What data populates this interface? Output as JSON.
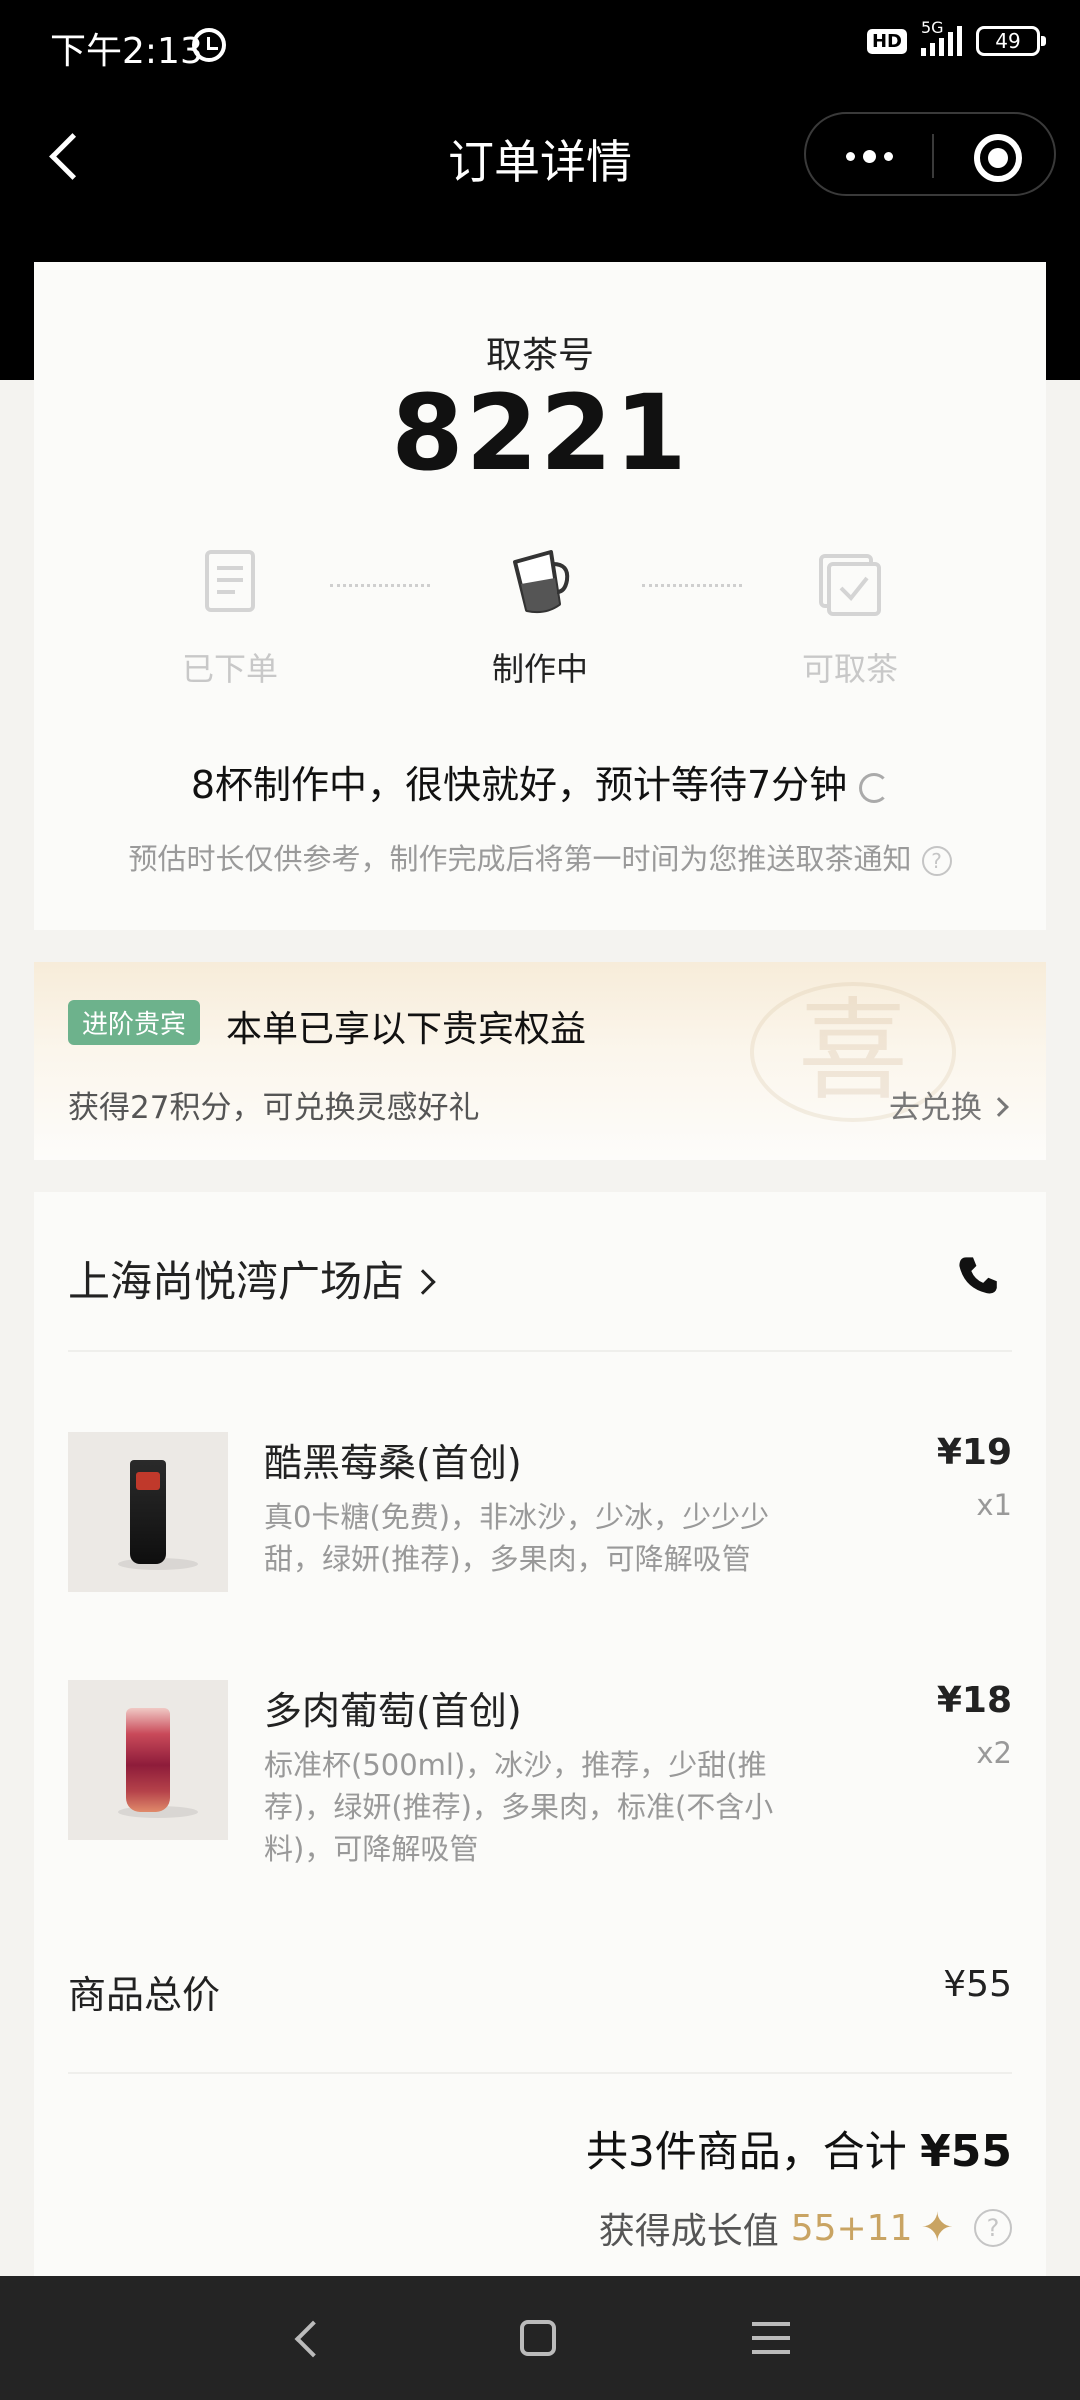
{
  "status_bar": {
    "time": "下午2:13",
    "network": "5G",
    "hd": "HD",
    "battery": "49"
  },
  "nav": {
    "title": "订单详情"
  },
  "pickup": {
    "label": "取茶号",
    "number": "8221",
    "steps": [
      {
        "label": "已下单",
        "state": "done"
      },
      {
        "label": "制作中",
        "state": "active"
      },
      {
        "label": "可取茶",
        "state": "pending"
      }
    ],
    "wait_text": "8杯制作中，很快就好，预计等待7分钟",
    "note": "预估时长仅供参考，制作完成后将第一时间为您推送取茶通知"
  },
  "vip": {
    "badge": "进阶贵宾",
    "title": "本单已享以下贵宾权益",
    "points_text": "获得27积分，可兑换灵感好礼",
    "redeem": "去兑换",
    "seal_char": "喜"
  },
  "order": {
    "store": "上海尚悦湾广场店",
    "items": [
      {
        "name": "酷黑莓桑(首创)",
        "spec": "真0卡糖(免费)，非冰沙，少冰，少少少甜，绿妍(推荐)，多果肉，可降解吸管",
        "price": "¥19",
        "qty": "x1"
      },
      {
        "name": "多肉葡萄(首创)",
        "spec": "标准杯(500ml)，冰沙，推荐，少甜(推荐)，绿妍(推荐)，多果肉，标准(不含小料)，可降解吸管",
        "price": "¥18",
        "qty": "x2"
      }
    ],
    "subtotal_label": "商品总价",
    "subtotal_value": "¥55",
    "total_prefix": "共3件商品，合计",
    "total_amount": "¥55",
    "growth_label": "获得成长值",
    "growth_value": "55+11"
  },
  "colors": {
    "accent_gold": "#c9a463",
    "vip_green": "#6db28c",
    "nav_bg": "#000000"
  }
}
